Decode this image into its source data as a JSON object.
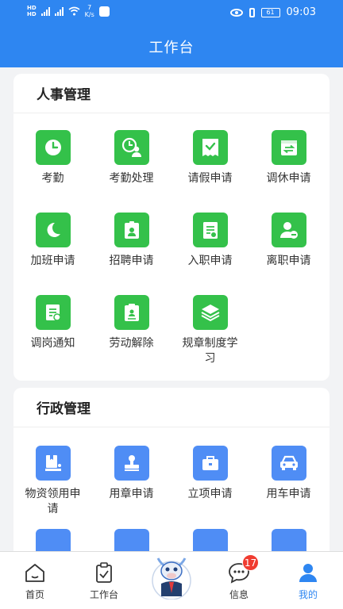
{
  "status_bar": {
    "network_left": "HD",
    "network_right": "HD",
    "speed_value": "7",
    "speed_unit": "K/s",
    "battery": "61",
    "time": "09:03"
  },
  "header": {
    "title": "工作台"
  },
  "hr_section": {
    "title": "人事管理",
    "items": [
      {
        "label": "考勤",
        "icon": "clock-icon"
      },
      {
        "label": "考勤处理",
        "icon": "attendance-user-icon"
      },
      {
        "label": "请假申请",
        "icon": "leave-icon"
      },
      {
        "label": "调休申请",
        "icon": "swap-icon"
      },
      {
        "label": "加班申请",
        "icon": "moon-icon"
      },
      {
        "label": "招聘申请",
        "icon": "badge-icon"
      },
      {
        "label": "入职申请",
        "icon": "document-icon"
      },
      {
        "label": "离职申请",
        "icon": "user-minus-icon"
      },
      {
        "label": "调岗通知",
        "icon": "notice-icon"
      },
      {
        "label": "劳动解除",
        "icon": "contract-icon"
      },
      {
        "label": "规章制度学习",
        "icon": "layers-icon"
      }
    ]
  },
  "admin_section": {
    "title": "行政管理",
    "items": [
      {
        "label": "物资领用申请",
        "icon": "box-icon"
      },
      {
        "label": "用章申请",
        "icon": "stamp-icon"
      },
      {
        "label": "立项申请",
        "icon": "briefcase-icon"
      },
      {
        "label": "用车申请",
        "icon": "car-icon"
      }
    ]
  },
  "tabbar": {
    "home": "首页",
    "workbench": "工作台",
    "messages": "信息",
    "message_badge": "17",
    "mine": "我的"
  },
  "colors": {
    "brand_blue": "#2e86f1",
    "icon_green": "#34c14a",
    "icon_blue": "#4f8df5",
    "badge_red": "#f03b30"
  }
}
